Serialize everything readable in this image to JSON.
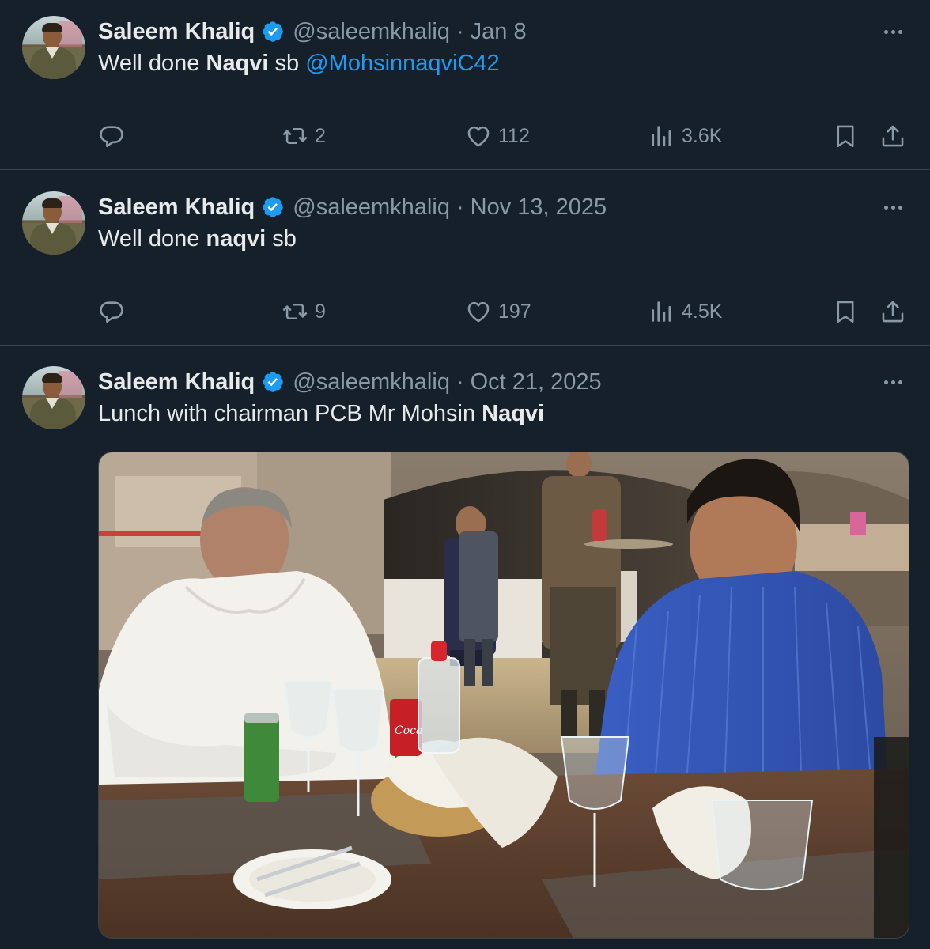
{
  "tweets": [
    {
      "author_name": "Saleem Khaliq",
      "handle": "@saleemkhaliq",
      "separator": "·",
      "date": "Jan 8",
      "text_pre": "Well done ",
      "text_bold": "Naqvi",
      "text_post": " sb ",
      "mention": "@MohsinnaqviC42",
      "replies": "",
      "retweets": "2",
      "likes": "112",
      "views": "3.6K"
    },
    {
      "author_name": "Saleem Khaliq",
      "handle": "@saleemkhaliq",
      "separator": "·",
      "date": "Nov 13, 2025",
      "text_pre": "Well done ",
      "text_bold": "naqvi",
      "text_post": " sb",
      "mention": "",
      "replies": "",
      "retweets": "9",
      "likes": "197",
      "views": "4.5K"
    },
    {
      "author_name": "Saleem Khaliq",
      "handle": "@saleemkhaliq",
      "separator": "·",
      "date": "Oct 21, 2025",
      "text_pre": "Lunch with chairman PCB Mr Mohsin ",
      "text_bold": "Naqvi",
      "text_post": "",
      "mention": "",
      "can_text": "Coca"
    }
  ],
  "colors": {
    "background": "#15202b",
    "accent": "#1d9bf0",
    "muted": "#8b98a5",
    "divider": "#38444d"
  },
  "icons": [
    "verified-badge-icon",
    "more-icon",
    "reply-icon",
    "retweet-icon",
    "like-icon",
    "views-icon",
    "bookmark-icon",
    "share-icon"
  ]
}
